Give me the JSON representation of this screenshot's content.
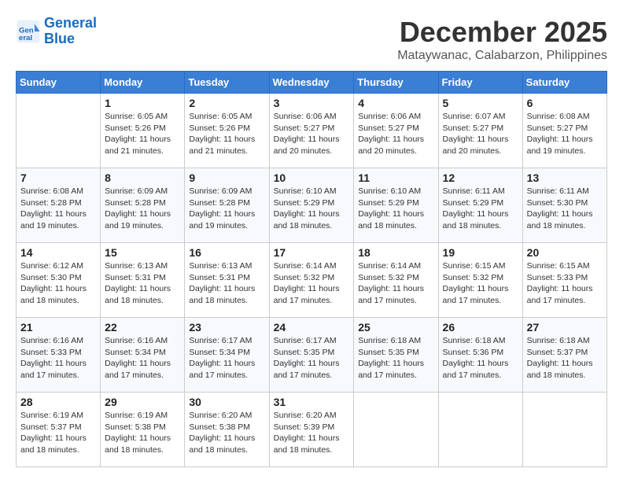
{
  "logo": {
    "line1": "General",
    "line2": "Blue"
  },
  "title": "December 2025",
  "location": "Mataywanac, Calabarzon, Philippines",
  "weekdays": [
    "Sunday",
    "Monday",
    "Tuesday",
    "Wednesday",
    "Thursday",
    "Friday",
    "Saturday"
  ],
  "weeks": [
    [
      {
        "day": "",
        "sunrise": "",
        "sunset": "",
        "daylight": ""
      },
      {
        "day": "1",
        "sunrise": "Sunrise: 6:05 AM",
        "sunset": "Sunset: 5:26 PM",
        "daylight": "Daylight: 11 hours and 21 minutes."
      },
      {
        "day": "2",
        "sunrise": "Sunrise: 6:05 AM",
        "sunset": "Sunset: 5:26 PM",
        "daylight": "Daylight: 11 hours and 21 minutes."
      },
      {
        "day": "3",
        "sunrise": "Sunrise: 6:06 AM",
        "sunset": "Sunset: 5:27 PM",
        "daylight": "Daylight: 11 hours and 20 minutes."
      },
      {
        "day": "4",
        "sunrise": "Sunrise: 6:06 AM",
        "sunset": "Sunset: 5:27 PM",
        "daylight": "Daylight: 11 hours and 20 minutes."
      },
      {
        "day": "5",
        "sunrise": "Sunrise: 6:07 AM",
        "sunset": "Sunset: 5:27 PM",
        "daylight": "Daylight: 11 hours and 20 minutes."
      },
      {
        "day": "6",
        "sunrise": "Sunrise: 6:08 AM",
        "sunset": "Sunset: 5:27 PM",
        "daylight": "Daylight: 11 hours and 19 minutes."
      }
    ],
    [
      {
        "day": "7",
        "sunrise": "Sunrise: 6:08 AM",
        "sunset": "Sunset: 5:28 PM",
        "daylight": "Daylight: 11 hours and 19 minutes."
      },
      {
        "day": "8",
        "sunrise": "Sunrise: 6:09 AM",
        "sunset": "Sunset: 5:28 PM",
        "daylight": "Daylight: 11 hours and 19 minutes."
      },
      {
        "day": "9",
        "sunrise": "Sunrise: 6:09 AM",
        "sunset": "Sunset: 5:28 PM",
        "daylight": "Daylight: 11 hours and 19 minutes."
      },
      {
        "day": "10",
        "sunrise": "Sunrise: 6:10 AM",
        "sunset": "Sunset: 5:29 PM",
        "daylight": "Daylight: 11 hours and 18 minutes."
      },
      {
        "day": "11",
        "sunrise": "Sunrise: 6:10 AM",
        "sunset": "Sunset: 5:29 PM",
        "daylight": "Daylight: 11 hours and 18 minutes."
      },
      {
        "day": "12",
        "sunrise": "Sunrise: 6:11 AM",
        "sunset": "Sunset: 5:29 PM",
        "daylight": "Daylight: 11 hours and 18 minutes."
      },
      {
        "day": "13",
        "sunrise": "Sunrise: 6:11 AM",
        "sunset": "Sunset: 5:30 PM",
        "daylight": "Daylight: 11 hours and 18 minutes."
      }
    ],
    [
      {
        "day": "14",
        "sunrise": "Sunrise: 6:12 AM",
        "sunset": "Sunset: 5:30 PM",
        "daylight": "Daylight: 11 hours and 18 minutes."
      },
      {
        "day": "15",
        "sunrise": "Sunrise: 6:13 AM",
        "sunset": "Sunset: 5:31 PM",
        "daylight": "Daylight: 11 hours and 18 minutes."
      },
      {
        "day": "16",
        "sunrise": "Sunrise: 6:13 AM",
        "sunset": "Sunset: 5:31 PM",
        "daylight": "Daylight: 11 hours and 18 minutes."
      },
      {
        "day": "17",
        "sunrise": "Sunrise: 6:14 AM",
        "sunset": "Sunset: 5:32 PM",
        "daylight": "Daylight: 11 hours and 17 minutes."
      },
      {
        "day": "18",
        "sunrise": "Sunrise: 6:14 AM",
        "sunset": "Sunset: 5:32 PM",
        "daylight": "Daylight: 11 hours and 17 minutes."
      },
      {
        "day": "19",
        "sunrise": "Sunrise: 6:15 AM",
        "sunset": "Sunset: 5:32 PM",
        "daylight": "Daylight: 11 hours and 17 minutes."
      },
      {
        "day": "20",
        "sunrise": "Sunrise: 6:15 AM",
        "sunset": "Sunset: 5:33 PM",
        "daylight": "Daylight: 11 hours and 17 minutes."
      }
    ],
    [
      {
        "day": "21",
        "sunrise": "Sunrise: 6:16 AM",
        "sunset": "Sunset: 5:33 PM",
        "daylight": "Daylight: 11 hours and 17 minutes."
      },
      {
        "day": "22",
        "sunrise": "Sunrise: 6:16 AM",
        "sunset": "Sunset: 5:34 PM",
        "daylight": "Daylight: 11 hours and 17 minutes."
      },
      {
        "day": "23",
        "sunrise": "Sunrise: 6:17 AM",
        "sunset": "Sunset: 5:34 PM",
        "daylight": "Daylight: 11 hours and 17 minutes."
      },
      {
        "day": "24",
        "sunrise": "Sunrise: 6:17 AM",
        "sunset": "Sunset: 5:35 PM",
        "daylight": "Daylight: 11 hours and 17 minutes."
      },
      {
        "day": "25",
        "sunrise": "Sunrise: 6:18 AM",
        "sunset": "Sunset: 5:35 PM",
        "daylight": "Daylight: 11 hours and 17 minutes."
      },
      {
        "day": "26",
        "sunrise": "Sunrise: 6:18 AM",
        "sunset": "Sunset: 5:36 PM",
        "daylight": "Daylight: 11 hours and 17 minutes."
      },
      {
        "day": "27",
        "sunrise": "Sunrise: 6:18 AM",
        "sunset": "Sunset: 5:37 PM",
        "daylight": "Daylight: 11 hours and 18 minutes."
      }
    ],
    [
      {
        "day": "28",
        "sunrise": "Sunrise: 6:19 AM",
        "sunset": "Sunset: 5:37 PM",
        "daylight": "Daylight: 11 hours and 18 minutes."
      },
      {
        "day": "29",
        "sunrise": "Sunrise: 6:19 AM",
        "sunset": "Sunset: 5:38 PM",
        "daylight": "Daylight: 11 hours and 18 minutes."
      },
      {
        "day": "30",
        "sunrise": "Sunrise: 6:20 AM",
        "sunset": "Sunset: 5:38 PM",
        "daylight": "Daylight: 11 hours and 18 minutes."
      },
      {
        "day": "31",
        "sunrise": "Sunrise: 6:20 AM",
        "sunset": "Sunset: 5:39 PM",
        "daylight": "Daylight: 11 hours and 18 minutes."
      },
      {
        "day": "",
        "sunrise": "",
        "sunset": "",
        "daylight": ""
      },
      {
        "day": "",
        "sunrise": "",
        "sunset": "",
        "daylight": ""
      },
      {
        "day": "",
        "sunrise": "",
        "sunset": "",
        "daylight": ""
      }
    ]
  ]
}
